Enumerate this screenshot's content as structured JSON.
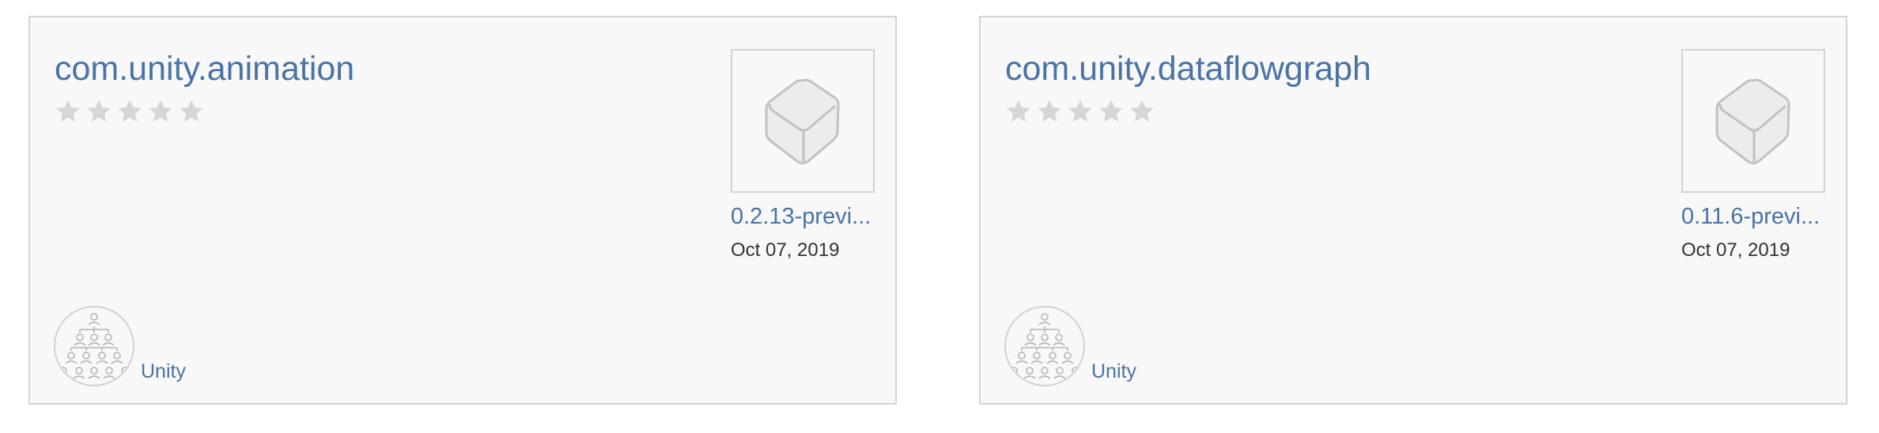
{
  "packages": [
    {
      "name": "com.unity.animation",
      "rating": 0,
      "max_rating": 5,
      "version": "0.2.13-previ...",
      "date": "Oct 07, 2019",
      "publisher": "Unity",
      "thumbnail_icon": "package-box-icon",
      "avatar_icon": "organization-icon"
    },
    {
      "name": "com.unity.dataflowgraph",
      "rating": 0,
      "max_rating": 5,
      "version": "0.11.6-previ...",
      "date": "Oct 07, 2019",
      "publisher": "Unity",
      "thumbnail_icon": "package-box-icon",
      "avatar_icon": "organization-icon"
    }
  ],
  "colors": {
    "link": "#4a72a6",
    "star_empty": "#d6d6d6",
    "card_bg": "#f8f8f8",
    "border": "#d4d4d4",
    "text": "#333333"
  }
}
